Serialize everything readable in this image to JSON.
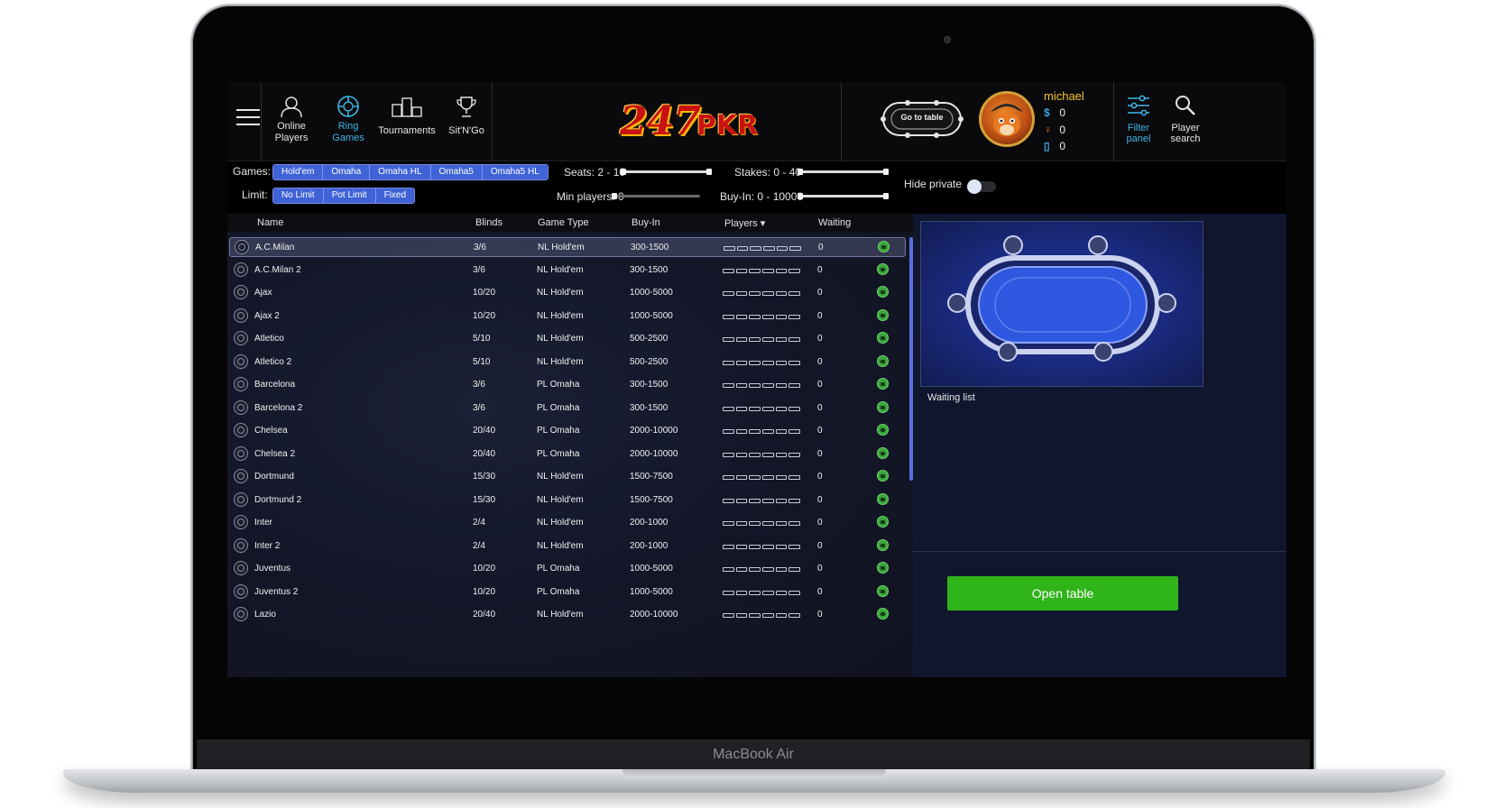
{
  "device": {
    "label": "MacBook Air"
  },
  "topbar": {
    "nav": [
      {
        "line1": "Online",
        "line2": "Players",
        "icon": "user-icon",
        "active": false
      },
      {
        "line1": "Ring",
        "line2": "Games",
        "icon": "poker-chip-icon",
        "active": true
      },
      {
        "line1": "Tournaments",
        "line2": "",
        "icon": "podium-icon",
        "active": false
      },
      {
        "line1": "Sit'N'Go",
        "line2": "",
        "icon": "trophy-icon",
        "active": false
      }
    ],
    "logo": {
      "number": "247",
      "text": "PKR"
    },
    "go_to_table": "Go to table",
    "user": {
      "name": "michael",
      "cash": "0",
      "points": "0",
      "tickets": "0"
    },
    "tools": [
      {
        "line1": "Filter",
        "line2": "panel",
        "icon": "sliders-icon"
      },
      {
        "line1": "Player",
        "line2": "search",
        "icon": "search-icon"
      }
    ]
  },
  "filters": {
    "games_label": "Games:",
    "games": [
      "Hold'em",
      "Omaha",
      "Omaha HL",
      "Omaha5",
      "Omaha5 HL"
    ],
    "limit_label": "Limit:",
    "limits": [
      "No Limit",
      "Pot Limit",
      "Fixed"
    ],
    "seats_label": "Seats: 2 - 10",
    "stakes_label": "Stakes: 0 - 40",
    "min_players_label": "Min players: 0",
    "buyin_label": "Buy-In: 0 - 10000",
    "hide_private_label": "Hide private"
  },
  "list": {
    "columns": {
      "name": "Name",
      "blinds": "Blinds",
      "game_type": "Game Type",
      "buyin": "Buy-In",
      "players": "Players",
      "waiting": "Waiting"
    },
    "rows": [
      {
        "name": "A.C.Milan",
        "blinds": "3/6",
        "type": "NL Hold'em",
        "buyin": "300-1500",
        "waiting": "0"
      },
      {
        "name": "A.C.Milan 2",
        "blinds": "3/6",
        "type": "NL Hold'em",
        "buyin": "300-1500",
        "waiting": "0"
      },
      {
        "name": "Ajax",
        "blinds": "10/20",
        "type": "NL Hold'em",
        "buyin": "1000-5000",
        "waiting": "0"
      },
      {
        "name": "Ajax 2",
        "blinds": "10/20",
        "type": "NL Hold'em",
        "buyin": "1000-5000",
        "waiting": "0"
      },
      {
        "name": "Atletico",
        "blinds": "5/10",
        "type": "NL Hold'em",
        "buyin": "500-2500",
        "waiting": "0"
      },
      {
        "name": "Atletico 2",
        "blinds": "5/10",
        "type": "NL Hold'em",
        "buyin": "500-2500",
        "waiting": "0"
      },
      {
        "name": "Barcelona",
        "blinds": "3/6",
        "type": "PL Omaha",
        "buyin": "300-1500",
        "waiting": "0"
      },
      {
        "name": "Barcelona 2",
        "blinds": "3/6",
        "type": "PL Omaha",
        "buyin": "300-1500",
        "waiting": "0"
      },
      {
        "name": "Chelsea",
        "blinds": "20/40",
        "type": "PL Omaha",
        "buyin": "2000-10000",
        "waiting": "0"
      },
      {
        "name": "Chelsea 2",
        "blinds": "20/40",
        "type": "PL Omaha",
        "buyin": "2000-10000",
        "waiting": "0"
      },
      {
        "name": "Dortmund",
        "blinds": "15/30",
        "type": "NL Hold'em",
        "buyin": "1500-7500",
        "waiting": "0"
      },
      {
        "name": "Dortmund 2",
        "blinds": "15/30",
        "type": "NL Hold'em",
        "buyin": "1500-7500",
        "waiting": "0"
      },
      {
        "name": "Inter",
        "blinds": "2/4",
        "type": "NL Hold'em",
        "buyin": "200-1000",
        "waiting": "0"
      },
      {
        "name": "Inter 2",
        "blinds": "2/4",
        "type": "NL Hold'em",
        "buyin": "200-1000",
        "waiting": "0"
      },
      {
        "name": "Juventus",
        "blinds": "10/20",
        "type": "PL Omaha",
        "buyin": "1000-5000",
        "waiting": "0"
      },
      {
        "name": "Juventus 2",
        "blinds": "10/20",
        "type": "PL Omaha",
        "buyin": "1000-5000",
        "waiting": "0"
      },
      {
        "name": "Lazio",
        "blinds": "20/40",
        "type": "NL Hold'em",
        "buyin": "2000-10000",
        "waiting": "0"
      }
    ]
  },
  "details": {
    "waiting_list_title": "Waiting list",
    "open_table": "Open table"
  },
  "colors": {
    "accent_blue": "#3f63d6",
    "open_button": "#2fb41a",
    "username": "#f2c12e",
    "active_nav": "#3fb6e6"
  }
}
